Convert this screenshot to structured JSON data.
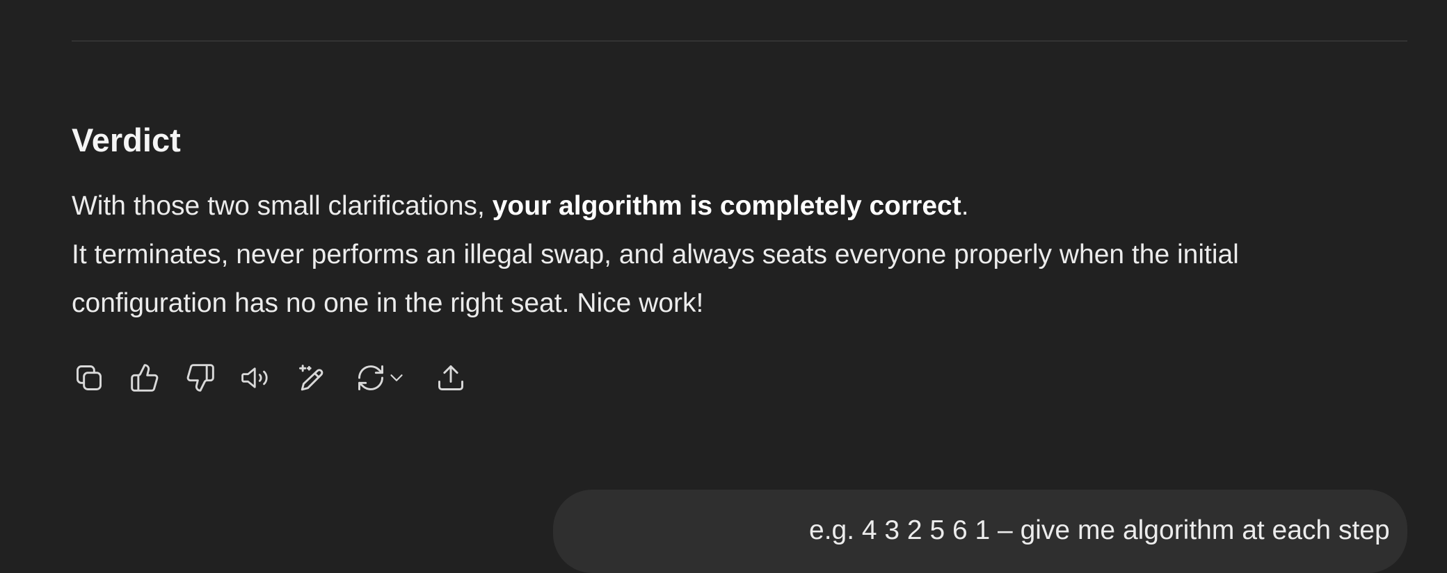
{
  "verdict": {
    "heading": "Verdict",
    "line1_plain": "With those two small clarifications, ",
    "line1_bold": "your algorithm is completely correct",
    "line1_end": ".",
    "line2": "It terminates, never performs an illegal swap, and always seats everyone properly when the initial",
    "line3": "configuration has no one in the right seat. Nice work!"
  },
  "toolbar": {
    "buttons": [
      {
        "icon": "copy-icon"
      },
      {
        "icon": "thumbs-up-icon"
      },
      {
        "icon": "thumbs-down-icon"
      },
      {
        "icon": "read-aloud-icon"
      },
      {
        "icon": "edit-sparkle-icon"
      },
      {
        "icon": "regenerate-icon"
      },
      {
        "icon": "share-icon"
      }
    ]
  },
  "next_message": {
    "text": "e.g. 4 3 2 5 6 1 – give me algorithm at each step"
  },
  "colors": {
    "background": "#212121",
    "text": "#ececec",
    "bubble": "#2f2f2f",
    "divider": "#333333"
  }
}
